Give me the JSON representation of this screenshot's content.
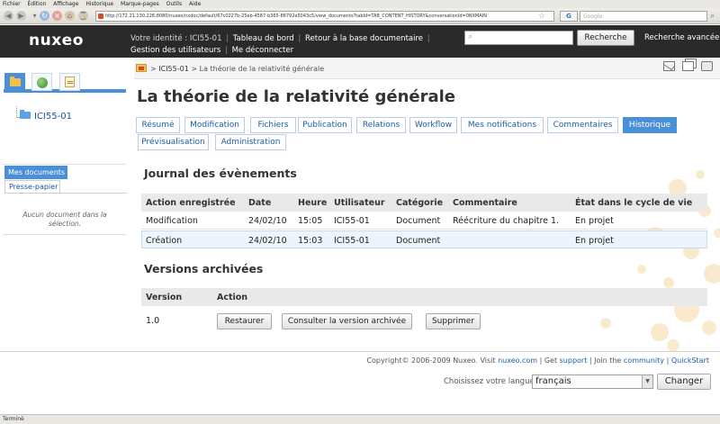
{
  "browser": {
    "menu": [
      "Fichier",
      "Édition",
      "Affichage",
      "Historique",
      "Marque-pages",
      "Outils",
      "Aide"
    ],
    "url": "http://172.21.130.226:8080/nuxeo/nxdoc/default/67c0227b-25eb-4587-b365-86792e5043c5/view_documents?tabId=TAB_CONTENT_HISTORY&conversationId=0NXMAIN",
    "search_placeholder": "Google",
    "google_label": "G",
    "status": "Terminé"
  },
  "header": {
    "logo": "nuxeo",
    "identity_prefix": "Votre identité : ",
    "user": "ICI55-01",
    "dashboard": "Tableau de bord",
    "back_to_docs": "Retour à la base documentaire",
    "user_mgmt": "Gestion des utilisateurs",
    "logout": "Me déconnecter",
    "search_button": "Recherche",
    "advanced_search": "Recherche avancée"
  },
  "sidebar": {
    "tree_item": "ICI55-01",
    "mydocs_tab": "Mes documents",
    "clipboard_tab": "Presse-papier",
    "empty_selection": "Aucun document dans la sélection."
  },
  "breadcrumb": {
    "sep": ">",
    "items": [
      "ICI55-01",
      "La théorie de la relativité générale"
    ]
  },
  "document": {
    "title": "La théorie de la relativité générale"
  },
  "tabs": [
    {
      "label": "Résumé"
    },
    {
      "label": "Modification"
    },
    {
      "label": "Fichiers"
    },
    {
      "label": "Publication"
    },
    {
      "label": "Relations"
    },
    {
      "label": "Workflow"
    },
    {
      "label": "Mes notifications"
    },
    {
      "label": "Commentaires"
    },
    {
      "label": "Historique"
    },
    {
      "label": "Prévisualisation"
    },
    {
      "label": "Administration"
    }
  ],
  "history": {
    "title": "Journal des évènements",
    "columns": [
      "Action enregistrée",
      "Date",
      "Heure",
      "Utilisateur",
      "Catégorie",
      "Commentaire",
      "État dans le cycle de vie"
    ],
    "rows": [
      [
        "Modification",
        "24/02/10",
        "15:05",
        "ICI55-01",
        "Document",
        "Réécriture du chapitre 1.",
        "En projet"
      ],
      [
        "Création",
        "24/02/10",
        "15:03",
        "ICI55-01",
        "Document",
        "",
        "En projet"
      ]
    ]
  },
  "versions": {
    "title": "Versions archivées",
    "columns": [
      "Version",
      "Action"
    ],
    "rows": [
      {
        "version": "1.0",
        "restore": "Restaurer",
        "view": "Consulter la version archivée",
        "delete": "Supprimer"
      }
    ]
  },
  "footer": {
    "copyright": "Copyright© 2006-2009 Nuxeo. Visit",
    "site": "nuxeo.com",
    "get": "| Get",
    "support": "support",
    "join": "| Join the",
    "community": "community",
    "sep": "|",
    "quickstart": "QuickStart",
    "lang_label": "Choisissez votre langue :",
    "lang_value": "français",
    "change": "Changer"
  },
  "colors": {
    "accent": "#4a90d9",
    "header_bg": "#2a2a2a",
    "link": "#1a5da8"
  }
}
